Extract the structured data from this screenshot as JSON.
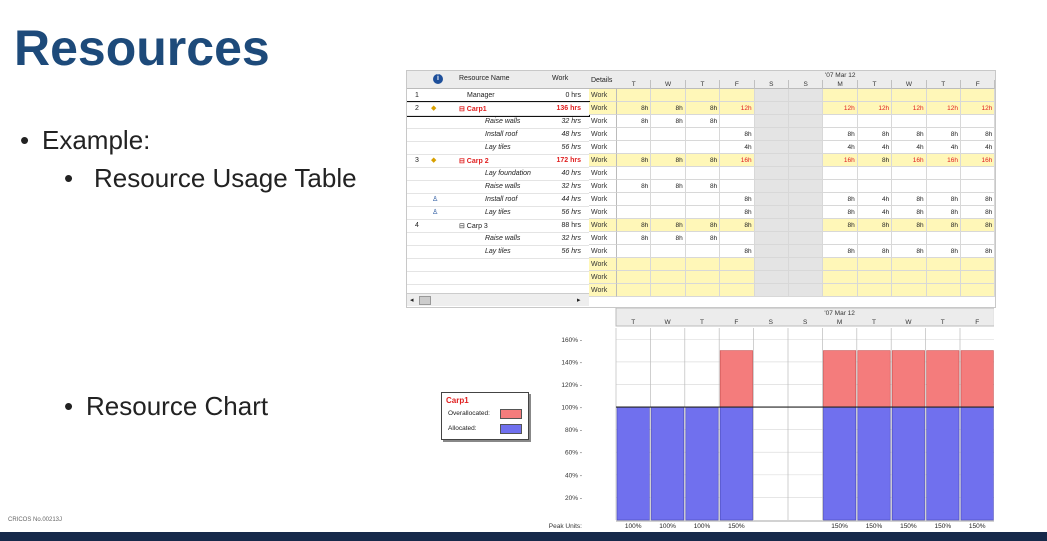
{
  "slide": {
    "title": "Resources",
    "bullets": [
      {
        "text": "Example:"
      },
      {
        "text": "Resource Usage Table"
      },
      {
        "text": "Resource Chart"
      }
    ],
    "footer_note": "CRICOS No.00213J"
  },
  "usage_table": {
    "columns": {
      "info": "i",
      "name": "Resource Name",
      "work": "Work",
      "details": "Details"
    },
    "week_labels": [
      "'07 Mar 12"
    ],
    "days": [
      "T",
      "W",
      "T",
      "F",
      "S",
      "S",
      "M",
      "T",
      "W",
      "T",
      "F"
    ],
    "rows": [
      {
        "id": "1",
        "name": "Manager",
        "work": "0 hrs",
        "indent": 0,
        "type": "resource",
        "detail": "Work",
        "values": [
          "",
          "",
          "",
          "",
          "",
          "",
          "",
          "",
          "",
          "",
          ""
        ]
      },
      {
        "id": "2",
        "name": "Carp1",
        "work": "136 hrs",
        "indent": 0,
        "type": "over",
        "detail": "Work",
        "values": [
          "8h",
          "8h",
          "8h",
          "12h",
          "",
          "",
          "12h",
          "12h",
          "12h",
          "12h",
          "12h"
        ]
      },
      {
        "id": "",
        "name": "Raise walls",
        "work": "32 hrs",
        "indent": 1,
        "type": "task",
        "detail": "Work",
        "values": [
          "8h",
          "8h",
          "8h",
          "",
          "",
          "",
          "",
          "",
          "",
          "",
          ""
        ]
      },
      {
        "id": "",
        "name": "Install roof",
        "work": "48 hrs",
        "indent": 1,
        "type": "task",
        "detail": "Work",
        "values": [
          "",
          "",
          "",
          "8h",
          "",
          "",
          "8h",
          "8h",
          "8h",
          "8h",
          "8h"
        ]
      },
      {
        "id": "",
        "name": "Lay tiles",
        "work": "56 hrs",
        "indent": 1,
        "type": "task",
        "detail": "Work",
        "values": [
          "",
          "",
          "",
          "4h",
          "",
          "",
          "4h",
          "4h",
          "4h",
          "4h",
          "4h"
        ]
      },
      {
        "id": "3",
        "name": "Carp 2",
        "work": "172 hrs",
        "indent": 0,
        "type": "over",
        "detail": "Work",
        "values": [
          "8h",
          "8h",
          "8h",
          "16h",
          "",
          "",
          "16h",
          "8h",
          "16h",
          "16h",
          "16h"
        ]
      },
      {
        "id": "",
        "name": "Lay foundation",
        "work": "40 hrs",
        "indent": 1,
        "type": "task",
        "detail": "Work",
        "values": [
          "",
          "",
          "",
          "",
          "",
          "",
          "",
          "",
          "",
          "",
          ""
        ]
      },
      {
        "id": "",
        "name": "Raise walls",
        "work": "32 hrs",
        "indent": 1,
        "type": "task",
        "detail": "Work",
        "values": [
          "8h",
          "8h",
          "8h",
          "",
          "",
          "",
          "",
          "",
          "",
          "",
          ""
        ]
      },
      {
        "id": "",
        "name": "Install roof",
        "work": "44 hrs",
        "indent": 1,
        "type": "task",
        "detail": "Work",
        "values": [
          "",
          "",
          "",
          "8h",
          "",
          "",
          "8h",
          "4h",
          "8h",
          "8h",
          "8h"
        ]
      },
      {
        "id": "",
        "name": "Lay tiles",
        "work": "56 hrs",
        "indent": 1,
        "type": "task",
        "detail": "Work",
        "values": [
          "",
          "",
          "",
          "8h",
          "",
          "",
          "8h",
          "4h",
          "8h",
          "8h",
          "8h"
        ]
      },
      {
        "id": "4",
        "name": "Carp 3",
        "work": "88 hrs",
        "indent": 0,
        "type": "resource",
        "detail": "Work",
        "values": [
          "8h",
          "8h",
          "8h",
          "8h",
          "",
          "",
          "8h",
          "8h",
          "8h",
          "8h",
          "8h"
        ]
      },
      {
        "id": "",
        "name": "Raise walls",
        "work": "32 hrs",
        "indent": 1,
        "type": "task",
        "detail": "Work",
        "values": [
          "8h",
          "8h",
          "8h",
          "",
          "",
          "",
          "",
          "",
          "",
          "",
          ""
        ]
      },
      {
        "id": "",
        "name": "Lay tiles",
        "work": "56 hrs",
        "indent": 1,
        "type": "task",
        "detail": "Work",
        "values": [
          "",
          "",
          "",
          "8h",
          "",
          "",
          "8h",
          "8h",
          "8h",
          "8h",
          "8h"
        ]
      },
      {
        "id": "",
        "name": "",
        "work": "",
        "indent": 0,
        "type": "empty",
        "detail": "Work",
        "values": [
          "",
          "",
          "",
          "",
          "",
          "",
          "",
          "",
          "",
          "",
          ""
        ]
      },
      {
        "id": "",
        "name": "",
        "work": "",
        "indent": 0,
        "type": "empty",
        "detail": "Work",
        "values": [
          "",
          "",
          "",
          "",
          "",
          "",
          "",
          "",
          "",
          "",
          ""
        ]
      },
      {
        "id": "",
        "name": "",
        "work": "",
        "indent": 0,
        "type": "empty",
        "detail": "Work",
        "values": [
          "",
          "",
          "",
          "",
          "",
          "",
          "",
          "",
          "",
          "",
          ""
        ]
      }
    ]
  },
  "resource_chart": {
    "week_label": "'07 Mar 12",
    "days": [
      "T",
      "W",
      "T",
      "F",
      "S",
      "S",
      "M",
      "T",
      "W",
      "T",
      "F"
    ],
    "y_ticks": [
      "160% -",
      "140% -",
      "120% -",
      "100% -",
      "80% -",
      "60% -",
      "40% -",
      "20% -"
    ],
    "peak_label": "Peak Units:",
    "legend": {
      "title": "Carp1",
      "overallocated": "Overallocated:",
      "allocated": "Allocated:"
    },
    "colors": {
      "overallocated": "#f47c7c",
      "allocated": "#7070ee"
    }
  },
  "chart_data": {
    "type": "bar",
    "categories": [
      "T",
      "W",
      "T",
      "F",
      "S",
      "S",
      "M",
      "T",
      "W",
      "T",
      "F"
    ],
    "series": [
      {
        "name": "Allocated",
        "values": [
          100,
          100,
          100,
          100,
          0,
          0,
          100,
          100,
          100,
          100,
          100
        ]
      },
      {
        "name": "Overallocated",
        "values": [
          0,
          0,
          0,
          50,
          0,
          0,
          50,
          50,
          50,
          50,
          50
        ]
      }
    ],
    "peak_units": [
      "100%",
      "100%",
      "100%",
      "150%",
      "",
      "",
      "150%",
      "150%",
      "150%",
      "150%",
      "150%"
    ],
    "ylim": [
      0,
      170
    ],
    "ylabel": "",
    "legend_title": "Carp1"
  }
}
